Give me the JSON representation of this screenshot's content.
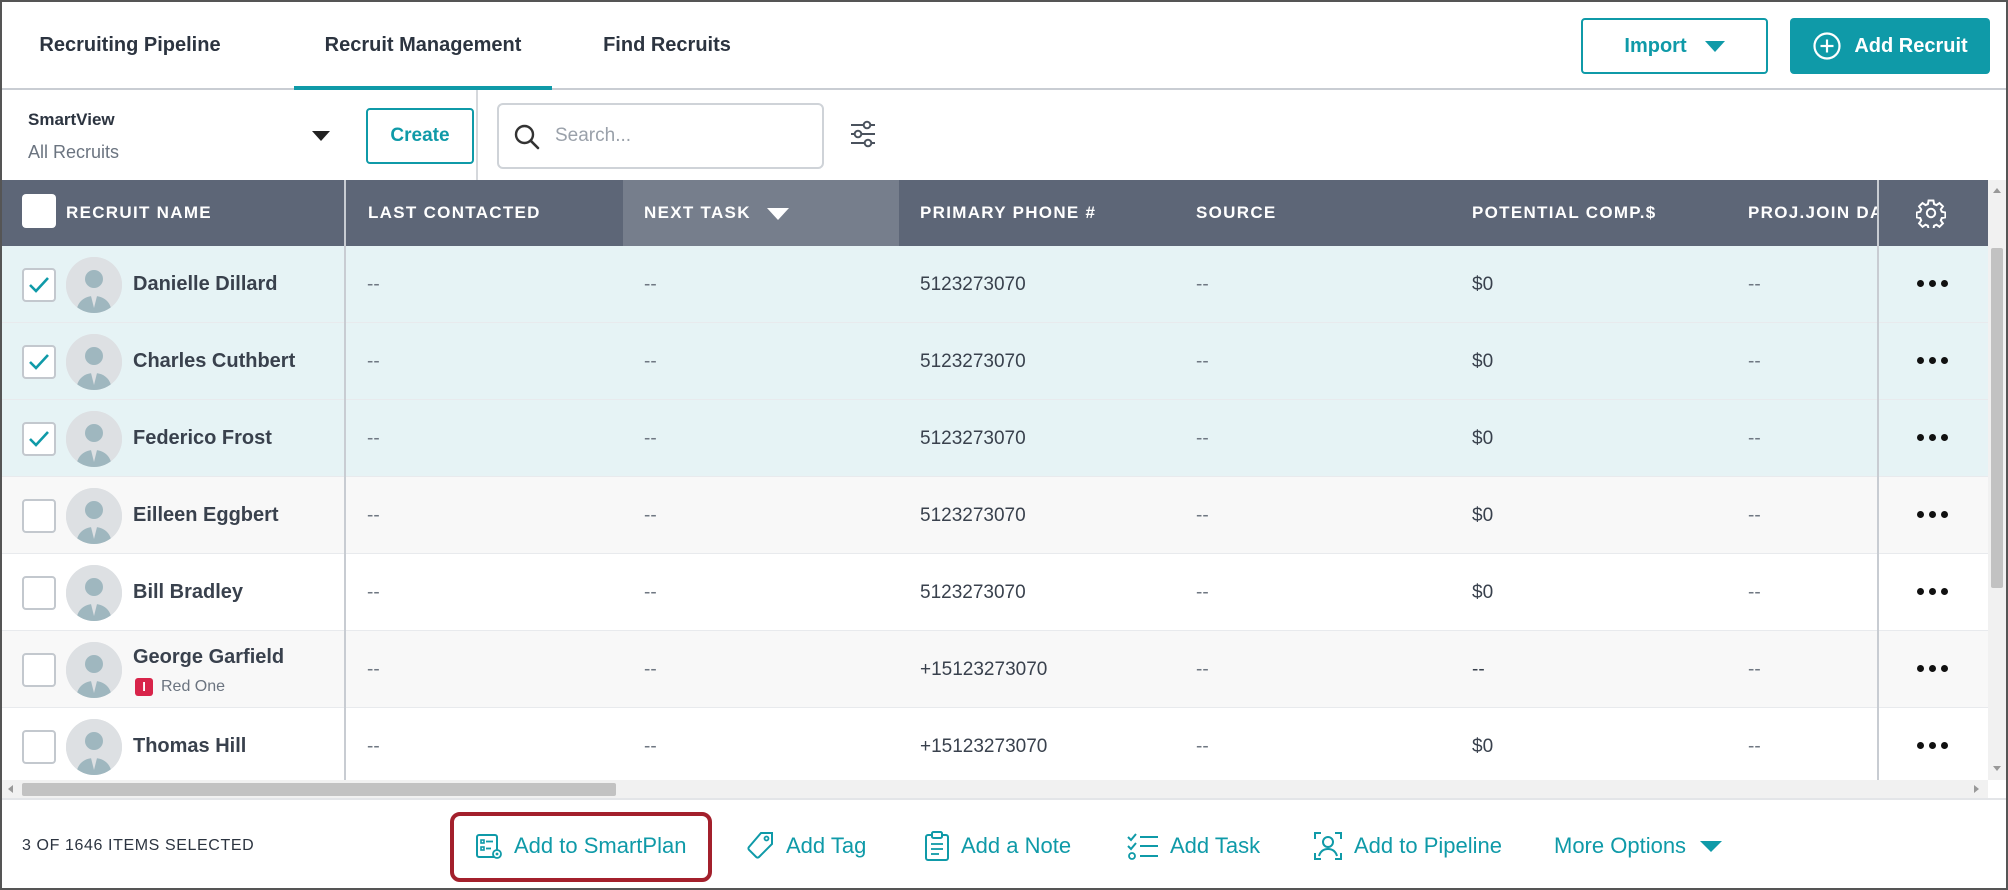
{
  "tabs": [
    {
      "label": "Recruiting Pipeline",
      "active": false
    },
    {
      "label": "Recruit Management",
      "active": true
    },
    {
      "label": "Find Recruits",
      "active": false
    }
  ],
  "header_actions": {
    "import_label": "Import",
    "add_recruit_label": "Add Recruit"
  },
  "filter": {
    "smartview_label": "SmartView",
    "smartview_value": "All Recruits",
    "create_label": "Create",
    "search_placeholder": "Search..."
  },
  "table": {
    "columns": [
      "RECRUIT NAME",
      "LAST CONTACTED",
      "NEXT TASK",
      "PRIMARY PHONE #",
      "SOURCE",
      "POTENTIAL COMP.$",
      "PROJ.JOIN DA"
    ],
    "sorted_column": "NEXT TASK",
    "rows": [
      {
        "name": "Danielle Dillard",
        "org": "",
        "checked": true,
        "last_contacted": "--",
        "next_task": "--",
        "phone": "5123273070",
        "source": "--",
        "comp": "$0",
        "join": "--"
      },
      {
        "name": "Charles Cuthbert",
        "org": "",
        "checked": true,
        "last_contacted": "--",
        "next_task": "--",
        "phone": "5123273070",
        "source": "--",
        "comp": "$0",
        "join": "--"
      },
      {
        "name": "Federico Frost",
        "org": "",
        "checked": true,
        "last_contacted": "--",
        "next_task": "--",
        "phone": "5123273070",
        "source": "--",
        "comp": "$0",
        "join": "--"
      },
      {
        "name": "Eilleen Eggbert",
        "org": "",
        "checked": false,
        "last_contacted": "--",
        "next_task": "--",
        "phone": "5123273070",
        "source": "--",
        "comp": "$0",
        "join": "--"
      },
      {
        "name": "Bill Bradley",
        "org": "",
        "checked": false,
        "last_contacted": "--",
        "next_task": "--",
        "phone": "5123273070",
        "source": "--",
        "comp": "$0",
        "join": "--"
      },
      {
        "name": "George Garfield",
        "org": "Red One",
        "org_badge": "I",
        "checked": false,
        "last_contacted": "--",
        "next_task": "--",
        "phone": "+15123273070",
        "source": "--",
        "comp": "--",
        "join": "--"
      },
      {
        "name": "Thomas Hill",
        "org": "",
        "checked": false,
        "last_contacted": "--",
        "next_task": "--",
        "phone": "+15123273070",
        "source": "--",
        "comp": "$0",
        "join": "--"
      }
    ]
  },
  "action_bar": {
    "selected_count": "3 OF 1646 ITEMS SELECTED",
    "actions": [
      {
        "label": "Add to SmartPlan",
        "icon": "smartplan-icon",
        "highlighted": true
      },
      {
        "label": "Add Tag",
        "icon": "tag-icon",
        "highlighted": false
      },
      {
        "label": "Add a Note",
        "icon": "clipboard-icon",
        "highlighted": false
      },
      {
        "label": "Add Task",
        "icon": "task-list-icon",
        "highlighted": false
      },
      {
        "label": "Add to Pipeline",
        "icon": "pipeline-icon",
        "highlighted": false
      },
      {
        "label": "More Options",
        "icon": "chevron-down-icon",
        "highlighted": false
      }
    ]
  },
  "colors": {
    "accent": "#0f9aa8",
    "header_bg": "#5d6677",
    "selected_row_bg": "#e6f3f5",
    "highlight_border": "#a3202c",
    "badge_red": "#d8244a"
  }
}
